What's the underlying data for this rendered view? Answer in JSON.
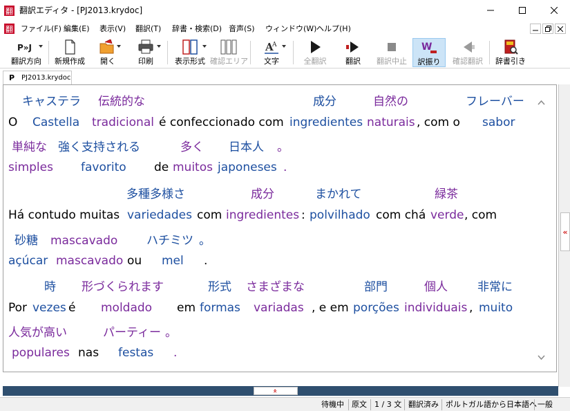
{
  "window": {
    "title": "翻訳エディタ - [PJ2013.krydoc]",
    "app_icon": "翻"
  },
  "menu": {
    "icon": "翻",
    "items": [
      "ファイル(F)",
      "編集(E)",
      "表示(V)",
      "翻訳(T)",
      "辞書・検索(D)",
      "音声(S)",
      "ウィンドウ(W)",
      "ヘルプ(H)"
    ]
  },
  "toolbar": {
    "direction_icon_text": "P»J",
    "buttons": [
      {
        "label": "翻訳方向",
        "icon": "direction-icon"
      },
      {
        "label": "新規作成",
        "icon": "new-document-icon"
      },
      {
        "label": "開く",
        "icon": "open-folder-icon"
      },
      {
        "label": "印刷",
        "icon": "printer-icon"
      },
      {
        "label": "表示形式",
        "icon": "display-format-icon"
      },
      {
        "label": "確認エリア",
        "icon": "confirm-area-icon"
      },
      {
        "label": "文字",
        "icon": "font-icon"
      },
      {
        "label": "全翻訳",
        "icon": "translate-all-icon"
      },
      {
        "label": "翻訳",
        "icon": "translate-icon"
      },
      {
        "label": "翻訳中止",
        "icon": "stop-icon"
      },
      {
        "label": "訳振り",
        "icon": "furigana-translation-icon"
      },
      {
        "label": "確認翻訳",
        "icon": "confirm-translation-icon"
      },
      {
        "label": "辞書引き",
        "icon": "dictionary-lookup-icon"
      }
    ]
  },
  "tab": {
    "icon_text": "P",
    "label": "PJ2013.krydoc"
  },
  "document": {
    "paragraphs": [
      {
        "jp": [
          "キャステラ",
          "伝統的な",
          "成分",
          "自然の",
          "フレーバー"
        ],
        "src": [
          "O",
          "Castella",
          "tradicional",
          "é confeccionado com",
          "ingredientes",
          "naturais",
          ", com o",
          "sabor"
        ]
      },
      {
        "jp": [
          "単純な",
          "強く支持される",
          "多く",
          "日本人",
          "。"
        ],
        "src": [
          "simples",
          "favorito",
          "de",
          "muitos",
          "japoneses",
          "."
        ]
      },
      {
        "jp": [
          "多種多様さ",
          "成分",
          "まかれて",
          "緑茶"
        ],
        "src": [
          "Há contudo muitas",
          "variedades",
          "com",
          "ingredientes",
          ":",
          "polvilhado",
          "com chá",
          "verde",
          ", com"
        ]
      },
      {
        "jp": [
          "砂糖",
          "mascavado",
          "ハチミツ",
          "。"
        ],
        "src": [
          "açúcar",
          "mascavado",
          "ou",
          "mel",
          "."
        ]
      },
      {
        "jp": [
          "時",
          "形づくられます",
          "形式",
          "さまざまな",
          "部門",
          "個人",
          "非常に"
        ],
        "src": [
          "Por",
          "vezes",
          "é",
          "moldado",
          "em",
          "formas",
          "variadas",
          ", e em",
          "porções",
          "individuais",
          ",",
          "muito"
        ]
      },
      {
        "jp": [
          "人気が高い",
          "パーティー",
          "。"
        ],
        "src": [
          "populares",
          "nas",
          "festas",
          "."
        ]
      }
    ]
  },
  "splitter": {
    "right_handle": "«",
    "bottom_handle": "»"
  },
  "status": {
    "items": [
      "待機中",
      "原文",
      "1 / 3 文",
      "翻訳済み",
      "ポルトガル語から日本語へ",
      "一般"
    ]
  },
  "colors": {
    "blue_word": "#1d4fa0",
    "purple_word": "#7a2a9c",
    "splitter": "#2f4f6f",
    "active_tool": "#cce4f7"
  }
}
